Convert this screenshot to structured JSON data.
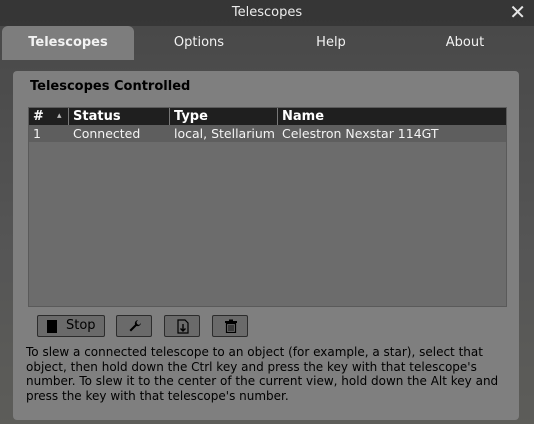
{
  "window": {
    "title": "Telescopes"
  },
  "tabs": [
    {
      "label": "Telescopes",
      "active": true
    },
    {
      "label": "Options",
      "active": false
    },
    {
      "label": "Help",
      "active": false
    },
    {
      "label": "About",
      "active": false
    }
  ],
  "section": {
    "title": "Telescopes Controlled"
  },
  "table": {
    "columns": [
      "#",
      "Status",
      "Type",
      "Name"
    ],
    "rows": [
      {
        "num": "1",
        "status": "Connected",
        "type": "local, Stellarium",
        "name": "Celestron Nexstar 114GT"
      }
    ]
  },
  "buttons": {
    "stop_label": "Stop",
    "stop_icon": "stop-icon",
    "configure_icon": "wrench-icon",
    "add_icon": "add-telescope-icon",
    "remove_icon": "trash-icon"
  },
  "help_text": "To slew a connected telescope to an object (for example, a star), select that object, then hold down the Ctrl key and press the key with that telescope's number. To slew it to the center of the current view, hold down the Alt key and press the key with that telescope's number."
}
